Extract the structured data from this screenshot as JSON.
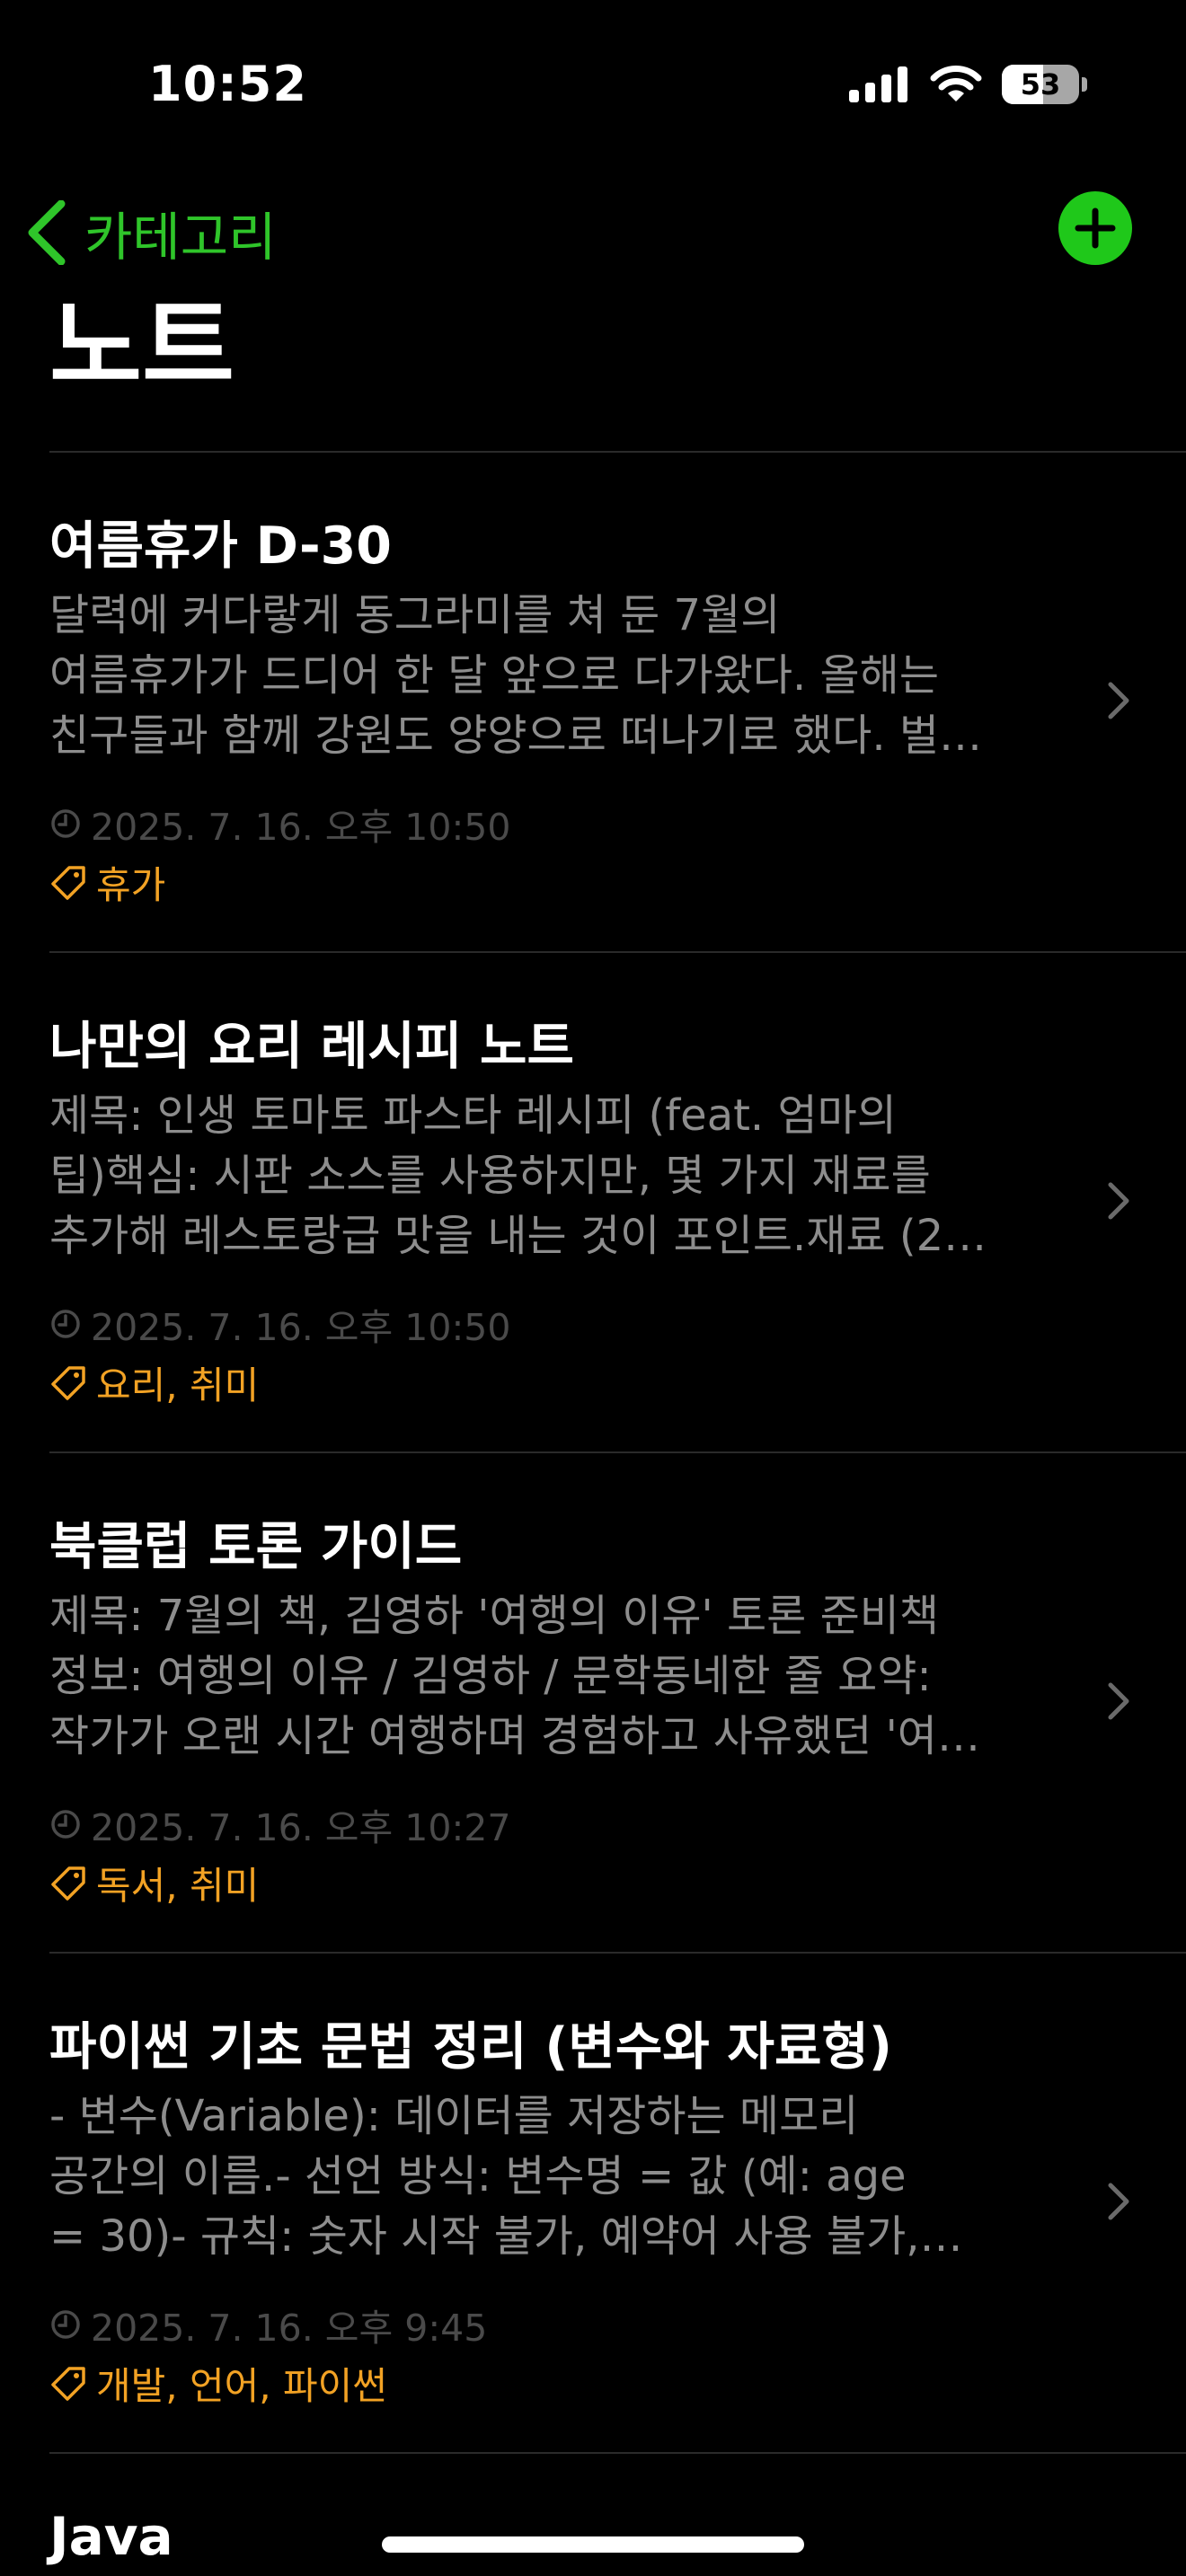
{
  "status_bar": {
    "time": "10:52",
    "battery_level": "53",
    "battery_fraction": 0.53,
    "icons": [
      "signal-icon",
      "wifi-icon",
      "battery-icon"
    ]
  },
  "nav": {
    "back_label": "카테고리",
    "back_icon": "chevron-left-icon",
    "add_icon": "plus-circle-icon",
    "accent_color": "#2fc52a"
  },
  "page": {
    "title": "노트"
  },
  "notes": [
    {
      "title": "여름휴가 D-30",
      "preview_lines": [
        "달력에 커다랗게 동그라미를 쳐 둔 7월의",
        "여름휴가가 드디어 한 달 앞으로 다가왔다. 올해는",
        "친구들과 함께 강원도 양양으로 떠나기로 했다. 벌…"
      ],
      "date": "2025. 7. 16. 오후 10:50",
      "tags": "휴가"
    },
    {
      "title": "나만의 요리 레시피 노트",
      "preview_lines": [
        "제목: 인생 토마토 파스타 레시피 (feat. 엄마의",
        "팁)핵심: 시판 소스를 사용하지만, 몇 가지 재료를",
        "추가해 레스토랑급 맛을 내는 것이 포인트.재료 (2…"
      ],
      "date": "2025. 7. 16. 오후 10:50",
      "tags": "요리, 취미"
    },
    {
      "title": "북클럽 토론 가이드",
      "preview_lines": [
        "제목: 7월의 책, 김영하 '여행의 이유' 토론 준비책",
        "정보: 여행의 이유 / 김영하 / 문학동네한 줄 요약:",
        "작가가 오랜 시간 여행하며 경험하고 사유했던 '여…"
      ],
      "date": "2025. 7. 16. 오후 10:27",
      "tags": "독서, 취미"
    },
    {
      "title": "파이썬 기초 문법 정리 (변수와 자료형)",
      "preview_lines": [
        "- 변수(Variable): 데이터를 저장하는 메모리",
        "공간의 이름.- 선언 방식: 변수명 = 값 (예: age",
        "= 30)- 규칙: 숫자 시작 불가, 예약어 사용 불가,…"
      ],
      "date": "2025. 7. 16. 오후 9:45",
      "tags": "개발, 언어, 파이썬"
    }
  ],
  "next_note_title": "Java",
  "colors": {
    "background": "#000000",
    "preview_text": "#8d8d8d",
    "date_text": "#4a4a4a",
    "tag_text": "#f2a224",
    "add_button": "#1fc81a"
  }
}
